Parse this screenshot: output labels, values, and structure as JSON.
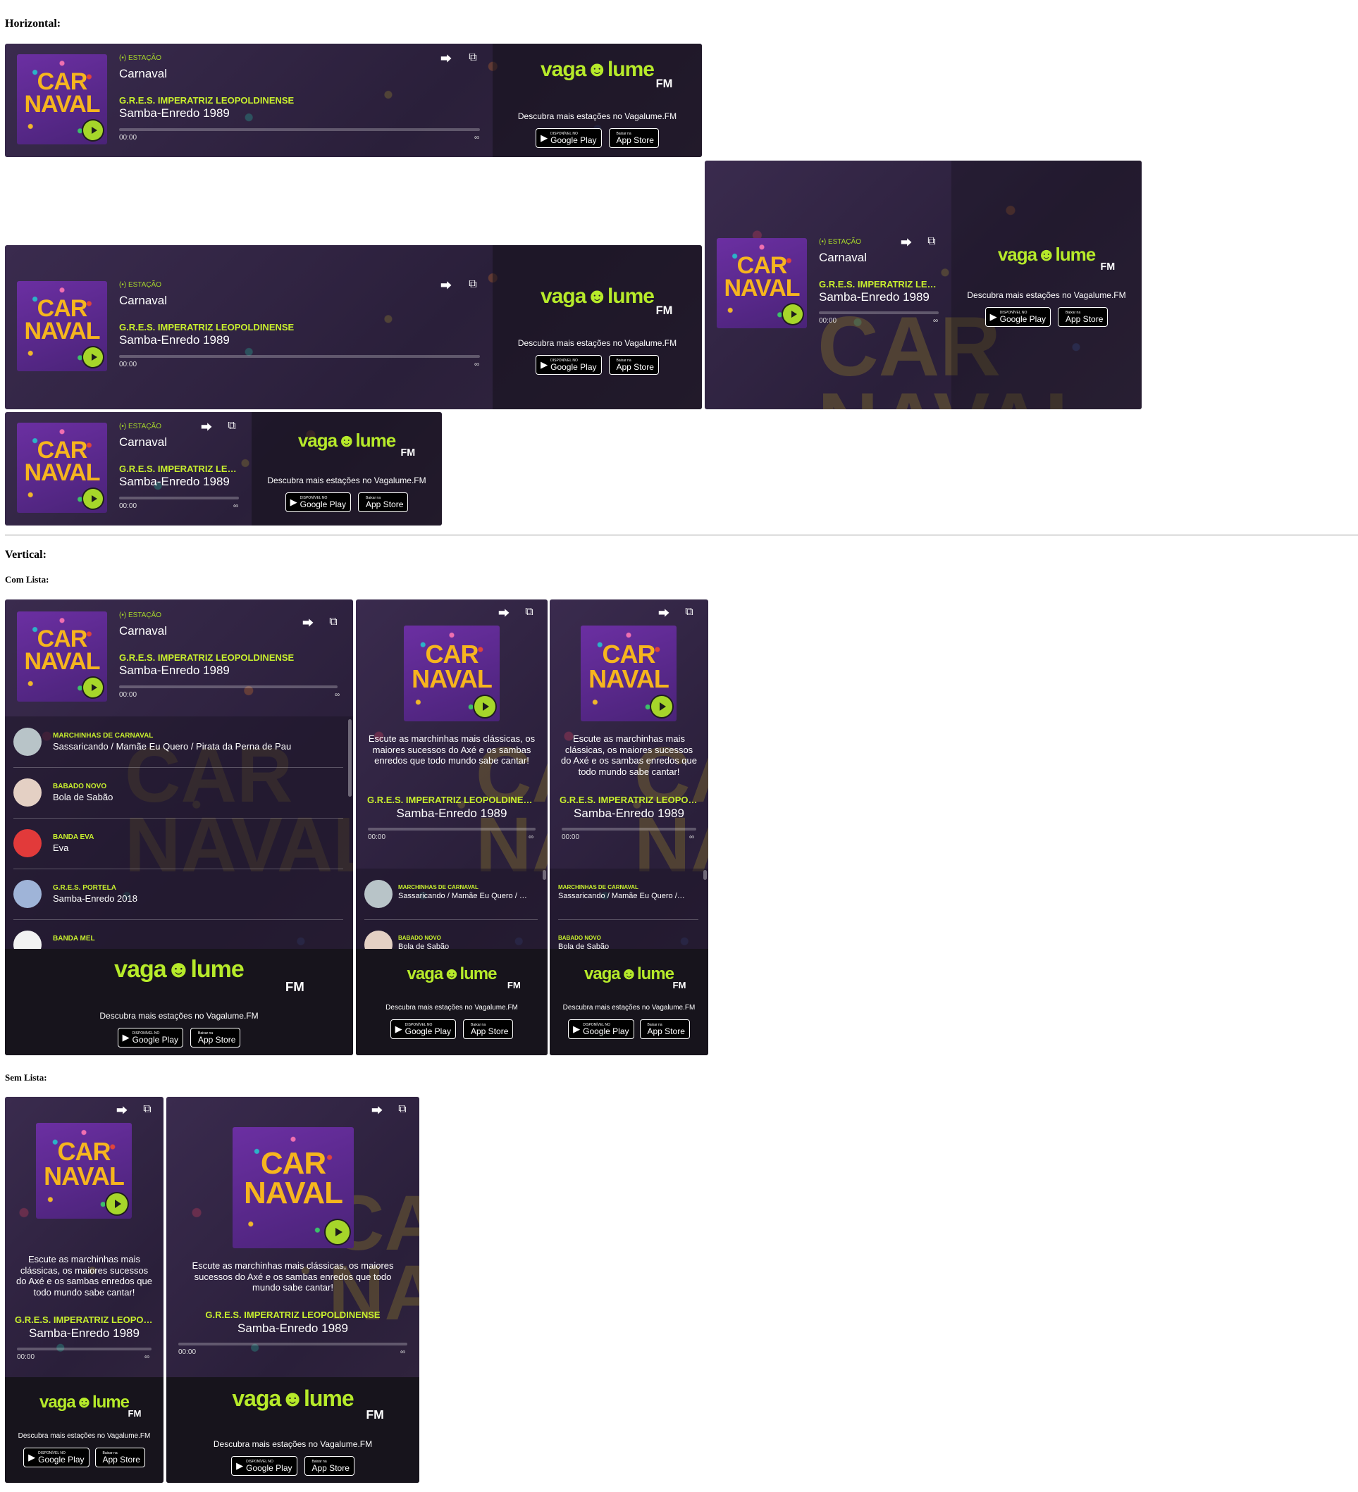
{
  "headings": {
    "horizontal": "Horizontal:",
    "vertical": "Vertical:",
    "com_lista": "Com Lista:",
    "sem_lista": "Sem Lista:"
  },
  "player": {
    "station_label": "ESTAÇÃO",
    "station_name": "Carnaval",
    "artist": "G.R.E.S. IMPERATRIZ LEOPOLDINENSE",
    "song": "Samba-Enredo 1989",
    "time": "00:00",
    "duration": "∞",
    "cover_text": "CAR NAVAL",
    "description": "Escute as marchinhas mais clássicas, os maiores sucessos do Axé e os sambas enredos que todo mundo sabe cantar!",
    "share_icon": "share-icon",
    "popout_icon": "external-window-icon",
    "play_icon": "play-icon"
  },
  "promo": {
    "logo_vaga": "vaga",
    "logo_lume": "lume",
    "logo_fm": "FM",
    "text": "Descubra mais estações no Vagalume.FM",
    "google_small": "DISPONÍVEL NO",
    "google_big": "Google Play",
    "apple_small": "Baixar na",
    "apple_big": "App Store"
  },
  "list": [
    {
      "artist": "MARCHINHAS DE CARNAVAL",
      "song": "Sassaricando / Mamãe Eu Quero / Pirata da Perna de Pau",
      "avatar": "#b8c4c8"
    },
    {
      "artist": "BABADO NOVO",
      "song": "Bola de Sabão",
      "avatar": "#e4d0c4"
    },
    {
      "artist": "BANDA EVA",
      "song": "Eva",
      "avatar": "#e23a3a"
    },
    {
      "artist": "G.R.E.S. PORTELA",
      "song": "Samba-Enredo 2018",
      "avatar": "#9fb4d8"
    },
    {
      "artist": "BANDA MEL",
      "song": "",
      "avatar": "#f2f2f2"
    }
  ],
  "colors": {
    "accent": "#c8ef2e",
    "background": "#2e2141",
    "play": "#a6d62a",
    "cover_text": "#f6b51e"
  }
}
